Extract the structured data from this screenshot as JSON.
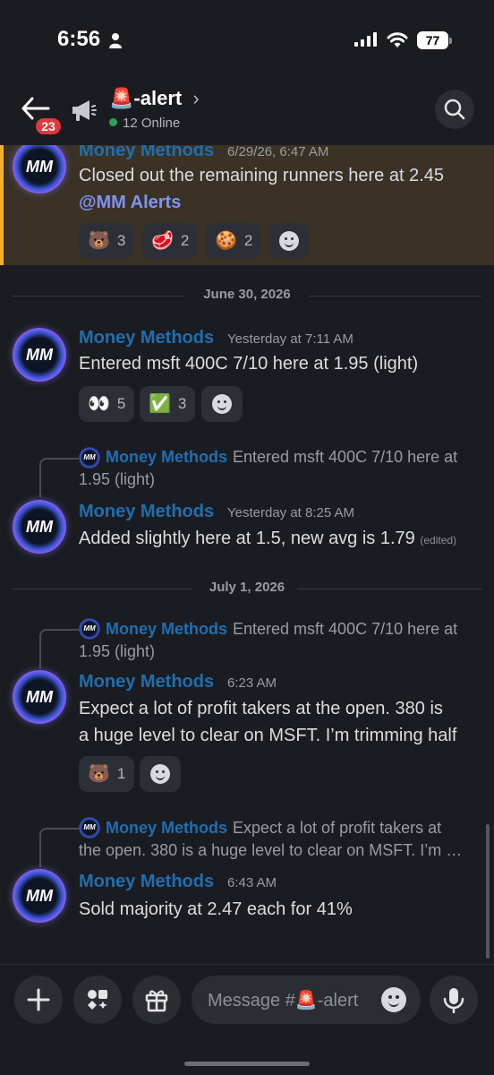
{
  "status": {
    "time": "6:56",
    "battery": "77"
  },
  "header": {
    "badge": "23",
    "channel_emoji": "🚨",
    "channel_name": "-alert",
    "chevron": "›",
    "online": "12 Online"
  },
  "messages": [
    {
      "author": "Money Methods",
      "time": "6/29/26, 6:47 AM",
      "text": "Closed out the remaining runners here at 2.45",
      "mention": "@MM Alerts",
      "reactions": [
        {
          "emoji": "🐻",
          "count": "3"
        },
        {
          "emoji": "🥩",
          "count": "2"
        },
        {
          "emoji": "🍪",
          "count": "2"
        }
      ]
    },
    {
      "author": "Money Methods",
      "time": "Yesterday at 7:11 AM",
      "text": "Entered msft 400C 7/10 here at 1.95 (light)",
      "reactions": [
        {
          "emoji": "👀",
          "count": "5"
        },
        {
          "emoji": "✅",
          "count": "3"
        }
      ]
    },
    {
      "reply_author": "Money Methods",
      "reply_text_line1": "Entered msft 400C 7/10 here at",
      "reply_text_line2": "1.95 (light)",
      "author": "Money Methods",
      "time": "Yesterday at 8:25 AM",
      "text": "Added slightly here at 1.5, new avg is 1.79",
      "edited": "(edited)"
    },
    {
      "reply_author": "Money Methods",
      "reply_text_line1": "Entered msft 400C 7/10 here at",
      "reply_text_line2": "1.95 (light)",
      "author": "Money Methods",
      "time": "6:23 AM",
      "text_line1": "Expect a lot of profit takers at the open. 380 is",
      "text_line2": "a huge level to clear on MSFT. I’m trimming half",
      "reactions": [
        {
          "emoji": "🐻",
          "count": "1"
        }
      ]
    },
    {
      "reply_author": "Money Methods",
      "reply_text_line1": "Expect a lot of profit takers at",
      "reply_text_line2": "the open. 380 is a huge level to clear on MSFT. I’m …",
      "author": "Money Methods",
      "time": "6:43 AM",
      "text": "Sold majority at 2.47 each for 41%"
    }
  ],
  "dividers": [
    "June 30, 2026",
    "July 1, 2026"
  ],
  "avatar_text": "MM",
  "composer": {
    "placeholder": "Message #",
    "channel_emoji": "🚨",
    "channel_name": "-alert"
  },
  "colors": {
    "author": "#1f6fb0",
    "mention": "#7f93f5",
    "highlight": "#3a3225",
    "highlight_border": "#f0b132",
    "online": "#23a55a"
  },
  "icons": [
    "back-arrow-icon",
    "megaphone-icon",
    "search-icon",
    "plus-icon",
    "apps-icon",
    "gift-icon",
    "emoji-icon",
    "microphone-icon"
  ]
}
